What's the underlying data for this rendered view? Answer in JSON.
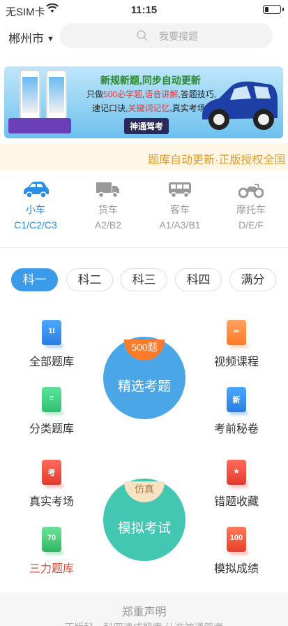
{
  "status_bar": {
    "carrier": "无SIM卡",
    "time": "11:15"
  },
  "top": {
    "city": "郴州市",
    "search_placeholder": "我要搜题"
  },
  "banner": {
    "line1": "新规新题,同步自动更新",
    "line2_a": "只做",
    "line2_b": "500必学题",
    "line2_c": ",",
    "line2_d": "语音讲解",
    "line2_e": ",答题技巧,",
    "line3_a": "速记口诀,",
    "line3_b": "关键词记忆",
    "line3_c": ",真实考场,",
    "brand": "神通驾考"
  },
  "marquee": "题库自动更新·正版授权全国",
  "vehicles": [
    {
      "name": "小车",
      "code": "C1/C2/C3",
      "icon": "car-icon"
    },
    {
      "name": "货车",
      "code": "A2/B2",
      "icon": "truck-icon"
    },
    {
      "name": "客车",
      "code": "A1/A3/B1",
      "icon": "bus-icon"
    },
    {
      "name": "摩托车",
      "code": "D/E/F",
      "icon": "motorcycle-icon"
    }
  ],
  "subjects": [
    "科一",
    "科二",
    "科三",
    "科四",
    "满分"
  ],
  "menu": {
    "all": "全部题库",
    "category": "分类题库",
    "real": "真实考场",
    "three": "三力题库",
    "video": "视频课程",
    "secret": "考前秘卷",
    "wrong": "错题收藏",
    "score": "模拟成绩"
  },
  "featured": {
    "badge": "500题",
    "title": "精选考题"
  },
  "mock": {
    "badge": "仿真",
    "title": "模拟考试"
  },
  "footer": {
    "title": "郑重声明",
    "text": "正版科一科四速成题库,认准神通驾考"
  },
  "colors": {
    "accent": "#3b9be8",
    "orange": "#ff8a3d",
    "green": "#3ccf7a",
    "red": "#f0483b",
    "marquee": "#e39a2c"
  }
}
